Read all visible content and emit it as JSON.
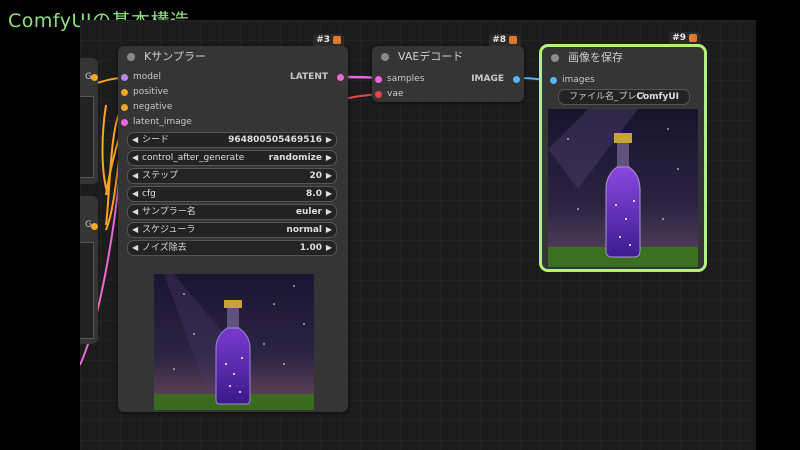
{
  "slide_title": "ComfyUIの基本構造",
  "colors": {
    "accent_green": "#8fe07d",
    "selected_outline": "#b4f07a",
    "wire_pink": "#e86bd6",
    "wire_red": "#e04a4a",
    "wire_blue": "#5ab4f0",
    "wire_orange": "#f5a623",
    "sock_purple": "#b48ae8"
  },
  "left_nodes": {
    "top_fragment_label": "G",
    "bottom_fragment_label": "G"
  },
  "ksampler": {
    "badge": "#3",
    "title": "Kサンプラー",
    "inputs": [
      "model",
      "positive",
      "negative",
      "latent_image"
    ],
    "output": "LATENT",
    "widgets": [
      {
        "label": "シード",
        "value": "964800505469516"
      },
      {
        "label": "control_after_generate",
        "value": "randomize"
      },
      {
        "label": "ステップ",
        "value": "20"
      },
      {
        "label": "cfg",
        "value": "8.0"
      },
      {
        "label": "サンプラー名",
        "value": "euler"
      },
      {
        "label": "スケジューラ",
        "value": "normal"
      },
      {
        "label": "ノイズ除去",
        "value": "1.00"
      }
    ],
    "preview_icon": "starry-bottle-preview"
  },
  "vae_decode": {
    "badge": "#8",
    "title": "VAEデコード",
    "inputs": [
      "samples",
      "vae"
    ],
    "output": "IMAGE"
  },
  "save_image": {
    "badge": "#9",
    "title": "画像を保存",
    "input": "images",
    "filename_label": "ファイル名_プレフ",
    "filename_value": "ComfyUI",
    "preview_icon": "starry-bottle-image"
  }
}
